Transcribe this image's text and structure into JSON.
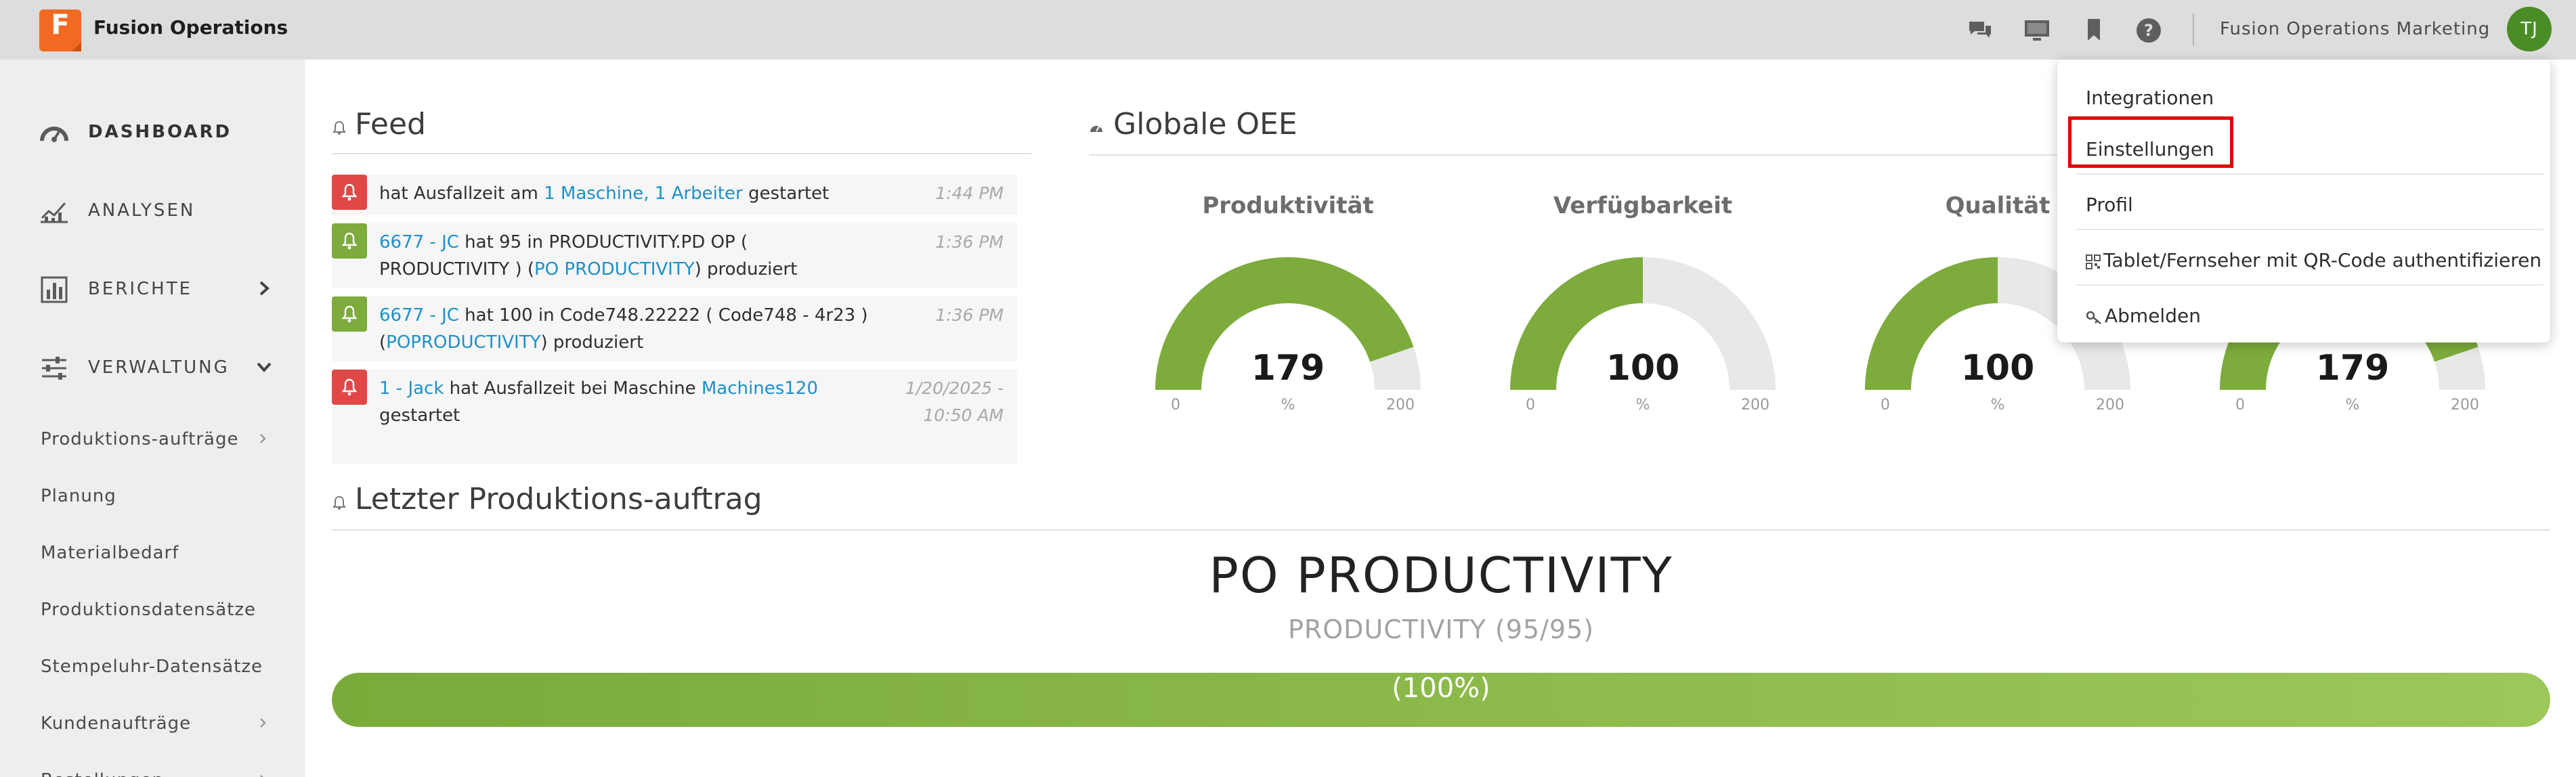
{
  "app": {
    "logo_letter": "F",
    "title": "Fusion Operations"
  },
  "topbar": {
    "icons": [
      "chat-icon",
      "monitor-icon",
      "bookmark-icon",
      "help-icon"
    ],
    "org_name": "Fusion Operations Marketing",
    "avatar_initials": "TJ"
  },
  "sidebar": {
    "main": [
      {
        "label": "DASHBOARD",
        "icon": "speedometer-icon",
        "active": true
      },
      {
        "label": "ANALYSEN",
        "icon": "line-chart-icon"
      },
      {
        "label": "BERICHTE",
        "icon": "bar-chart-icon",
        "chevron": "right"
      },
      {
        "label": "VERWALTUNG",
        "icon": "sliders-icon",
        "chevron": "down"
      }
    ],
    "sub": [
      {
        "label": "Produktions-aufträge",
        "chevron": true
      },
      {
        "label": "Planung"
      },
      {
        "label": "Materialbedarf"
      },
      {
        "label": "Produktionsdatensätze"
      },
      {
        "label": "Stempeluhr-Datensätze"
      },
      {
        "label": "Kundenaufträge",
        "chevron": true
      },
      {
        "label": "Bestellungen",
        "chevron": true
      }
    ]
  },
  "feed": {
    "title": "Feed",
    "items": [
      {
        "type": "red",
        "parts": [
          {
            "t": "hat Ausfallzeit am "
          },
          {
            "t": "1 Maschine, 1 Arbeiter",
            "link": true
          },
          {
            "t": " gestartet"
          }
        ],
        "time": "1:44 PM"
      },
      {
        "type": "green",
        "parts": [
          {
            "t": "6677 - JC",
            "link": true
          },
          {
            "t": " hat 95 in PRODUCTIVITY.PD OP ( PRODUCTIVITY ) ("
          },
          {
            "t": "PO PRODUCTIVITY",
            "link": true
          },
          {
            "t": ") produziert"
          }
        ],
        "time": "1:36 PM"
      },
      {
        "type": "green",
        "parts": [
          {
            "t": "6677 - JC",
            "link": true
          },
          {
            "t": " hat 100 in Code748.22222 ( Code748 - 4r23 ) ("
          },
          {
            "t": "POPRODUCTIVITY",
            "link": true
          },
          {
            "t": ") produziert"
          }
        ],
        "time": "1:36 PM"
      },
      {
        "type": "red",
        "parts": [
          {
            "t": "1 - Jack",
            "link": true
          },
          {
            "t": " hat Ausfallzeit bei Maschine "
          },
          {
            "t": "Machines120",
            "link": true
          },
          {
            "t": " gestartet"
          }
        ],
        "time": "1/20/2025 - 10:50 AM"
      }
    ]
  },
  "oee": {
    "title": "Globale OEE",
    "gauges": [
      {
        "title": "Produktivität",
        "value": 179,
        "min": "0",
        "max": "200",
        "unit": "%"
      },
      {
        "title": "Verfügbarkeit",
        "value": 100,
        "min": "0",
        "max": "200",
        "unit": "%"
      },
      {
        "title": "Qualität",
        "value": 100,
        "min": "0",
        "max": "200",
        "unit": "%"
      },
      {
        "title": "",
        "value": 179,
        "min": "0",
        "max": "200",
        "unit": "%"
      }
    ]
  },
  "last_order": {
    "title": "Letzter Produktions-auftrag",
    "name": "PO PRODUCTIVITY",
    "subtitle": "PRODUCTIVITY (95/95)",
    "progress": 100,
    "progress_label": "(100%)"
  },
  "dropdown": {
    "items": [
      "Integrationen",
      "Einstellungen",
      "Profil",
      "Tablet/Fernseher mit QR-Code authentifizieren",
      "Abmelden"
    ],
    "highlighted": "Einstellungen"
  },
  "colors": {
    "accent_green": "#7dab3c",
    "alert_red": "#e04848",
    "link_blue": "#1e90c9",
    "brand_orange": "#f26a21",
    "highlight_red": "#e00000"
  }
}
